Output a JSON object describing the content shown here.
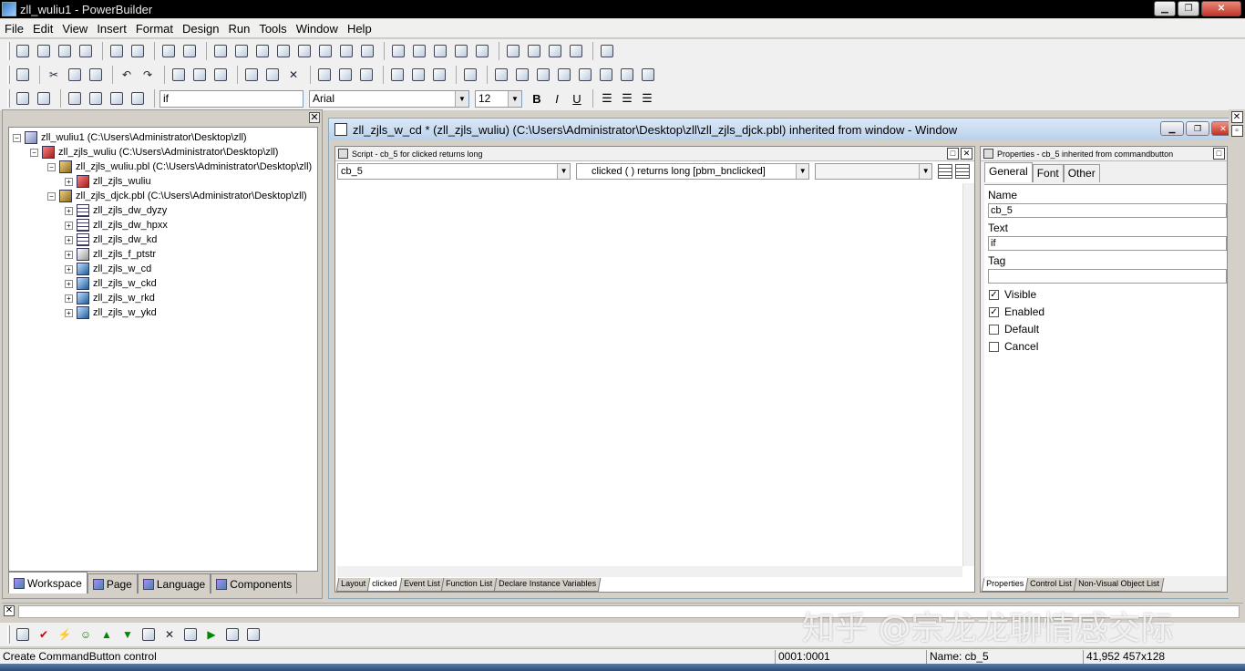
{
  "window": {
    "title": "zll_wuliu1 - PowerBuilder"
  },
  "menu": [
    "File",
    "Edit",
    "View",
    "Insert",
    "Format",
    "Design",
    "Run",
    "Tools",
    "Window",
    "Help"
  ],
  "format_bar": {
    "text_value": "if",
    "font": "Arial",
    "size": "12",
    "bold": "B",
    "italic": "I",
    "underline": "U"
  },
  "workspace": {
    "tree": [
      {
        "level": 0,
        "label": "zll_wuliu1 (C:\\Users\\Administrator\\Desktop\\zll)",
        "icon": "workspace-icon",
        "exp": "−"
      },
      {
        "level": 1,
        "label": "zll_zjls_wuliu (C:\\Users\\Administrator\\Desktop\\zll)",
        "icon": "target-icon",
        "exp": "−"
      },
      {
        "level": 2,
        "label": "zll_zjls_wuliu.pbl (C:\\Users\\Administrator\\Desktop\\zll)",
        "icon": "library-icon",
        "exp": "−"
      },
      {
        "level": 3,
        "label": "zll_zjls_wuliu",
        "icon": "application-icon",
        "exp": "+"
      },
      {
        "level": 2,
        "label": "zll_zjls_djck.pbl (C:\\Users\\Administrator\\Desktop\\zll)",
        "icon": "library-icon",
        "exp": "−"
      },
      {
        "level": 3,
        "label": "zll_zjls_dw_dyzy",
        "icon": "datawindow-icon",
        "exp": "+"
      },
      {
        "level": 3,
        "label": "zll_zjls_dw_hpxx",
        "icon": "datawindow-icon",
        "exp": "+"
      },
      {
        "level": 3,
        "label": "zll_zjls_dw_kd",
        "icon": "datawindow-icon",
        "exp": "+"
      },
      {
        "level": 3,
        "label": "zll_zjls_f_ptstr",
        "icon": "function-icon",
        "exp": "+"
      },
      {
        "level": 3,
        "label": "zll_zjls_w_cd",
        "icon": "window-icon",
        "exp": "+"
      },
      {
        "level": 3,
        "label": "zll_zjls_w_ckd",
        "icon": "window-icon",
        "exp": "+"
      },
      {
        "level": 3,
        "label": "zll_zjls_w_rkd",
        "icon": "window-icon",
        "exp": "+"
      },
      {
        "level": 3,
        "label": "zll_zjls_w_ykd",
        "icon": "window-icon",
        "exp": "+"
      }
    ],
    "tabs": [
      "Workspace",
      "Page",
      "Language",
      "Components"
    ]
  },
  "painter": {
    "title": "zll_zjls_w_cd * (zll_zjls_wuliu) (C:\\Users\\Administrator\\Desktop\\zll\\zll_zjls_djck.pbl) inherited from window - Window",
    "script": {
      "header": "Script - cb_5 for clicked returns long",
      "object_combo": "cb_5",
      "event_combo": "clicked ( )  returns long [pbm_bnclicked]",
      "ancestor_combo": "",
      "tabs": [
        "Layout",
        "clicked",
        "Event List",
        "Function List",
        "Declare Instance Variables"
      ]
    },
    "properties": {
      "header": "Properties - cb_5 inherited from commandbutton",
      "tabs": [
        "General",
        "Font",
        "Other"
      ],
      "name_label": "Name",
      "name_value": "cb_5",
      "text_label": "Text",
      "text_value": "if",
      "tag_label": "Tag",
      "tag_value": "",
      "checks": [
        {
          "label": "Visible",
          "checked": true
        },
        {
          "label": "Enabled",
          "checked": true
        },
        {
          "label": "Default",
          "checked": false
        },
        {
          "label": "Cancel",
          "checked": false
        }
      ],
      "bottom_tabs": [
        "Properties",
        "Control List",
        "Non-Visual Object List"
      ]
    }
  },
  "status": {
    "message": "Create CommandButton control",
    "position": "0001:0001",
    "name": "Name: cb_5",
    "geometry": "41,952 457x128"
  },
  "watermark": "知乎 @宗龙龙聊情感交际"
}
